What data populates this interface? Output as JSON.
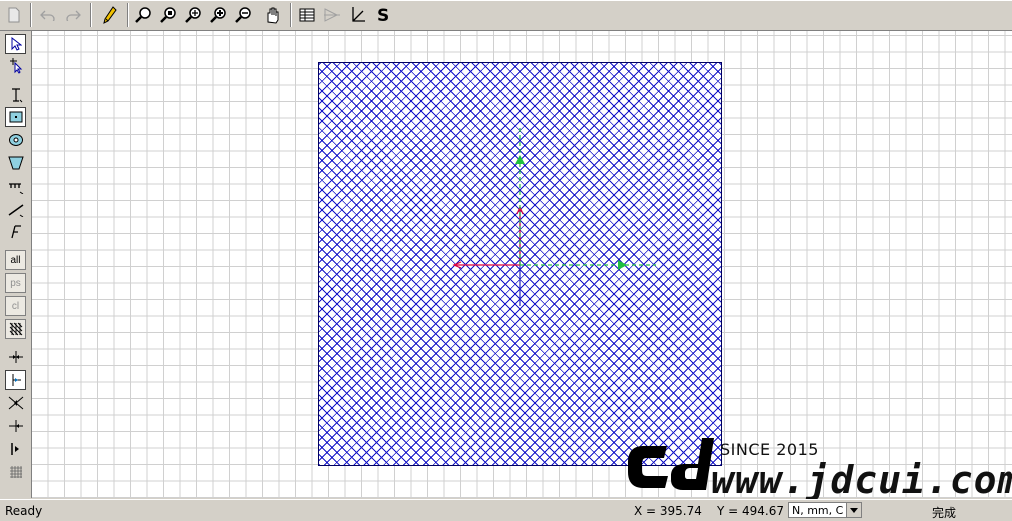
{
  "toolbar": {
    "icons": [
      "new-icon",
      "undo-icon",
      "redo-icon",
      "pencil-icon",
      "zoom-icon",
      "zoom-window-icon",
      "zoom-in-icon",
      "zoom-in-alt-icon",
      "zoom-out-icon",
      "pan-hand-icon",
      "table-icon",
      "tool-view-icon",
      "coordinate-icon",
      "s-icon"
    ]
  },
  "sidebar": {
    "tools": [
      "select-arrow-icon",
      "select-node-icon",
      "text-tool-icon",
      "rectangle-tool-icon",
      "circle-tool-icon",
      "polygon-tool-icon",
      "dimension-tool-icon",
      "line-tool-icon",
      "f-tool-icon",
      "all-icon",
      "ps-icon",
      "cl-icon",
      "hatch-icon",
      "snap-mid-icon",
      "snap-end-icon",
      "mirror-icon",
      "align-left-icon",
      "align-edge-icon",
      "grid-snap-icon"
    ],
    "labels": {
      "all": "all",
      "ps": "ps",
      "cl": "cl"
    }
  },
  "watermark": {
    "since": "SINCE 2015",
    "url": "www.jdcui.com"
  },
  "status": {
    "ready": "Ready",
    "x": "X = 395.74",
    "y": "Y = 494.67",
    "units": "N, mm, C",
    "done": "完成"
  },
  "colors": {
    "hatch": "#1414c8",
    "axis_x_red": "#e0003c",
    "axis_y_blue": "#2020c0",
    "axis_green": "#20c040"
  }
}
